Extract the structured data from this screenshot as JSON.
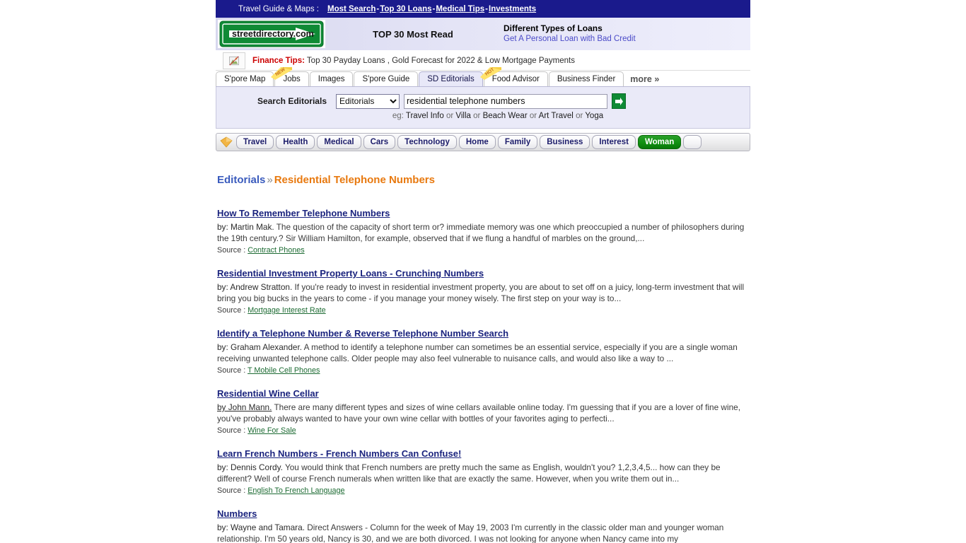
{
  "topbar": {
    "label": "Travel Guide & Maps :",
    "links": [
      "Most Search",
      "Top 30 Loans",
      "Medical Tips",
      "Investments"
    ],
    "separator": "-",
    "bg_color": "#1a1a8c"
  },
  "brand": {
    "logo_text": "streetdirectory.com",
    "logo_color": "#0f8a35"
  },
  "band": {
    "middle_title": "TOP 30 Most Read",
    "promo_title": "Different Types of Loans",
    "promo_sub": "Get A Personal Loan with Bad Credit"
  },
  "tips": {
    "label": "Finance Tips:",
    "text": "Top 30 Payday Loans , Gold Forecast for 2022 & Low Mortgage Payments",
    "label_color": "#cc0000"
  },
  "tabs": {
    "items": [
      {
        "label": "S'pore Map",
        "badge": "",
        "active": false
      },
      {
        "label": "Jobs",
        "badge": "NEW",
        "active": false
      },
      {
        "label": "Images",
        "badge": "",
        "active": false
      },
      {
        "label": "S'pore Guide",
        "badge": "",
        "active": false
      },
      {
        "label": "SD Editorials",
        "badge": "",
        "active": true
      },
      {
        "label": "Food Advisor",
        "badge": "HOT",
        "active": false
      },
      {
        "label": "Business Finder",
        "badge": "",
        "active": false
      }
    ],
    "more_label": "more »"
  },
  "search": {
    "label": "Search Editorials",
    "select_value": "Editorials",
    "select_options": [
      "Editorials"
    ],
    "input_value": "residential telephone numbers",
    "input_placeholder": "",
    "go_label": "GO",
    "example_prefix": "eg:",
    "example_terms": [
      "Travel Info",
      "Villa",
      "Beach Wear",
      "Art Travel",
      "Yoga"
    ],
    "example_joiner": "or"
  },
  "catnav": {
    "items": [
      {
        "label": "Travel",
        "selected": false
      },
      {
        "label": "Health",
        "selected": false
      },
      {
        "label": "Medical",
        "selected": false
      },
      {
        "label": "Cars",
        "selected": false
      },
      {
        "label": "Technology",
        "selected": false
      },
      {
        "label": "Home",
        "selected": false
      },
      {
        "label": "Family",
        "selected": false
      },
      {
        "label": "Business",
        "selected": false
      },
      {
        "label": "Interest",
        "selected": false
      },
      {
        "label": "Woman",
        "selected": true
      }
    ],
    "selected_color": "#119111"
  },
  "breadcrumb": {
    "root": "Editorials",
    "chevron": "»",
    "current": "Residential Telephone Numbers",
    "root_color": "#3a5bbd",
    "current_color": "#e8790f"
  },
  "articles": [
    {
      "title": "How To Remember Telephone Numbers",
      "by": "by: Martin Mak.",
      "by_underlined": false,
      "body": " The question of the capacity of short term or? immediate memory was one which preoccupied a number of philosophers during the 19th century.? Sir William Hamilton, for example, observed that if we flung a handful of marbles on the ground,...",
      "source_label": "Source :",
      "source_link": "Contract Phones"
    },
    {
      "title": "Residential Investment Property Loans - Crunching Numbers",
      "by": "by: Andrew Stratton.",
      "by_underlined": false,
      "body": " If you're ready to invest in residential investment property, you are about to set off on a juicy, long-term investment that will bring you big bucks in the years to come - if you manage your money wisely. The first step on your way is to...",
      "source_label": "Source :",
      "source_link": "Mortgage Interest Rate"
    },
    {
      "title": "Identify a Telephone Number & Reverse Telephone Number Search",
      "by": "by: Graham Alexander.",
      "by_underlined": false,
      "body": " A method to identify a telephone number can sometimes be an essential service, especially if you are a single woman receiving unwanted telephone calls. Older people may also feel vulnerable to nuisance calls, and would also like a way to ...",
      "source_label": "Source :",
      "source_link": "T Mobile Cell Phones"
    },
    {
      "title": "Residential Wine Cellar",
      "by": "by John Mann.",
      "by_underlined": true,
      "body": " There are many different types and sizes of wine cellars available online today. I'm guessing that if you are a lover of fine wine, you've probably always wanted to have your own wine cellar with bottles of your favorites aging to perfecti...",
      "source_label": "Source :",
      "source_link": "Wine For Sale"
    },
    {
      "title": "Learn French Numbers - French Numbers Can Confuse!",
      "by": "by: Dennis Cordy.",
      "by_underlined": false,
      "body": " You would think that French numbers are pretty much the same as English, wouldn't you? 1,2,3,4,5... how can they be different? Well of course French numerals when written like that are exactly the same. However, when you write them out in...",
      "source_label": "Source :",
      "source_link": "English To French Language"
    },
    {
      "title": "Numbers",
      "by": "by: Wayne and Tamara.",
      "by_underlined": false,
      "body": " Direct Answers - Column for the week of May 19, 2003 I'm currently in the classic older man and younger woman relationship. I'm 50 years old, Nancy is 30, and we are both divorced. I was not looking for anyone when Nancy came into my",
      "source_label": "",
      "source_link": ""
    }
  ]
}
